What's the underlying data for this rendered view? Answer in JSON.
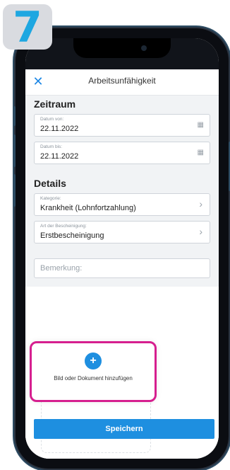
{
  "step": {
    "number": "7"
  },
  "header": {
    "title": "Arbeitsunfähigkeit",
    "close_icon": "close-icon"
  },
  "zeitraum": {
    "heading": "Zeitraum",
    "from": {
      "label": "Datum von:",
      "value": "22.11.2022"
    },
    "to": {
      "label": "Datum bis:",
      "value": "22.11.2022"
    }
  },
  "details": {
    "heading": "Details",
    "category": {
      "label": "Kategorie:",
      "value": "Krankheit (Lohnfortzahlung)"
    },
    "certificate": {
      "label": "Art der Bescheinigung:",
      "value": "Erstbescheinigung"
    }
  },
  "notes": {
    "placeholder": "Bemerkung:"
  },
  "upload": {
    "plus": "+",
    "label": "Bild oder Dokument hinzufügen"
  },
  "footer": {
    "save_label": "Speichern"
  },
  "colors": {
    "accent": "#1e8fe0",
    "highlight": "#d61f8f",
    "badge_number": "#1ea7e1"
  }
}
